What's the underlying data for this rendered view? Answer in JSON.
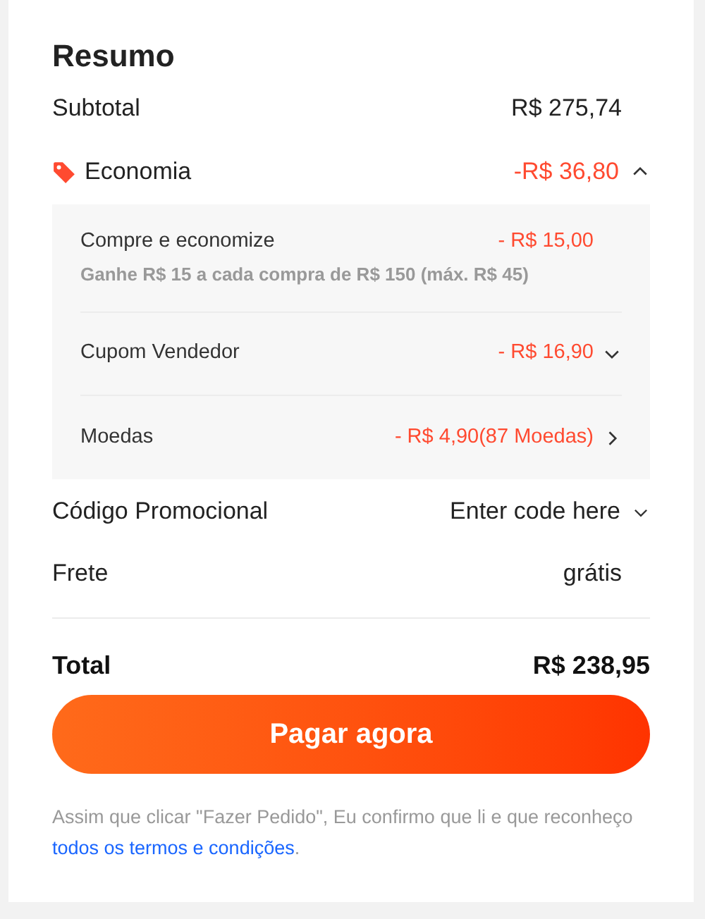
{
  "title": "Resumo",
  "subtotal": {
    "label": "Subtotal",
    "value": "R$ 275,74"
  },
  "savings": {
    "label": "Economia",
    "value": "-R$ 36,80",
    "expanded": true,
    "items": [
      {
        "label": "Compre e economize",
        "value": "- R$ 15,00",
        "note": "Ganhe R$ 15 a cada compra de R$ 150 (máx. R$ 45)",
        "kind": "note"
      },
      {
        "label": "Cupom Vendedor",
        "value": "- R$ 16,90",
        "kind": "dropdown"
      },
      {
        "label": "Moedas",
        "value": "- R$ 4,90(87 Moedas)",
        "kind": "link"
      }
    ]
  },
  "promo_code": {
    "label": "Código Promocional",
    "value": "Enter code here"
  },
  "shipping": {
    "label": "Frete",
    "value": "grátis"
  },
  "total": {
    "label": "Total",
    "value": "R$ 238,95"
  },
  "pay_button": "Pagar agora",
  "disclaimer": {
    "before": "Assim que clicar \"Fazer Pedido\", Eu confirmo que li e que reconheço ",
    "link": "todos os termos e condições",
    "after": "."
  }
}
